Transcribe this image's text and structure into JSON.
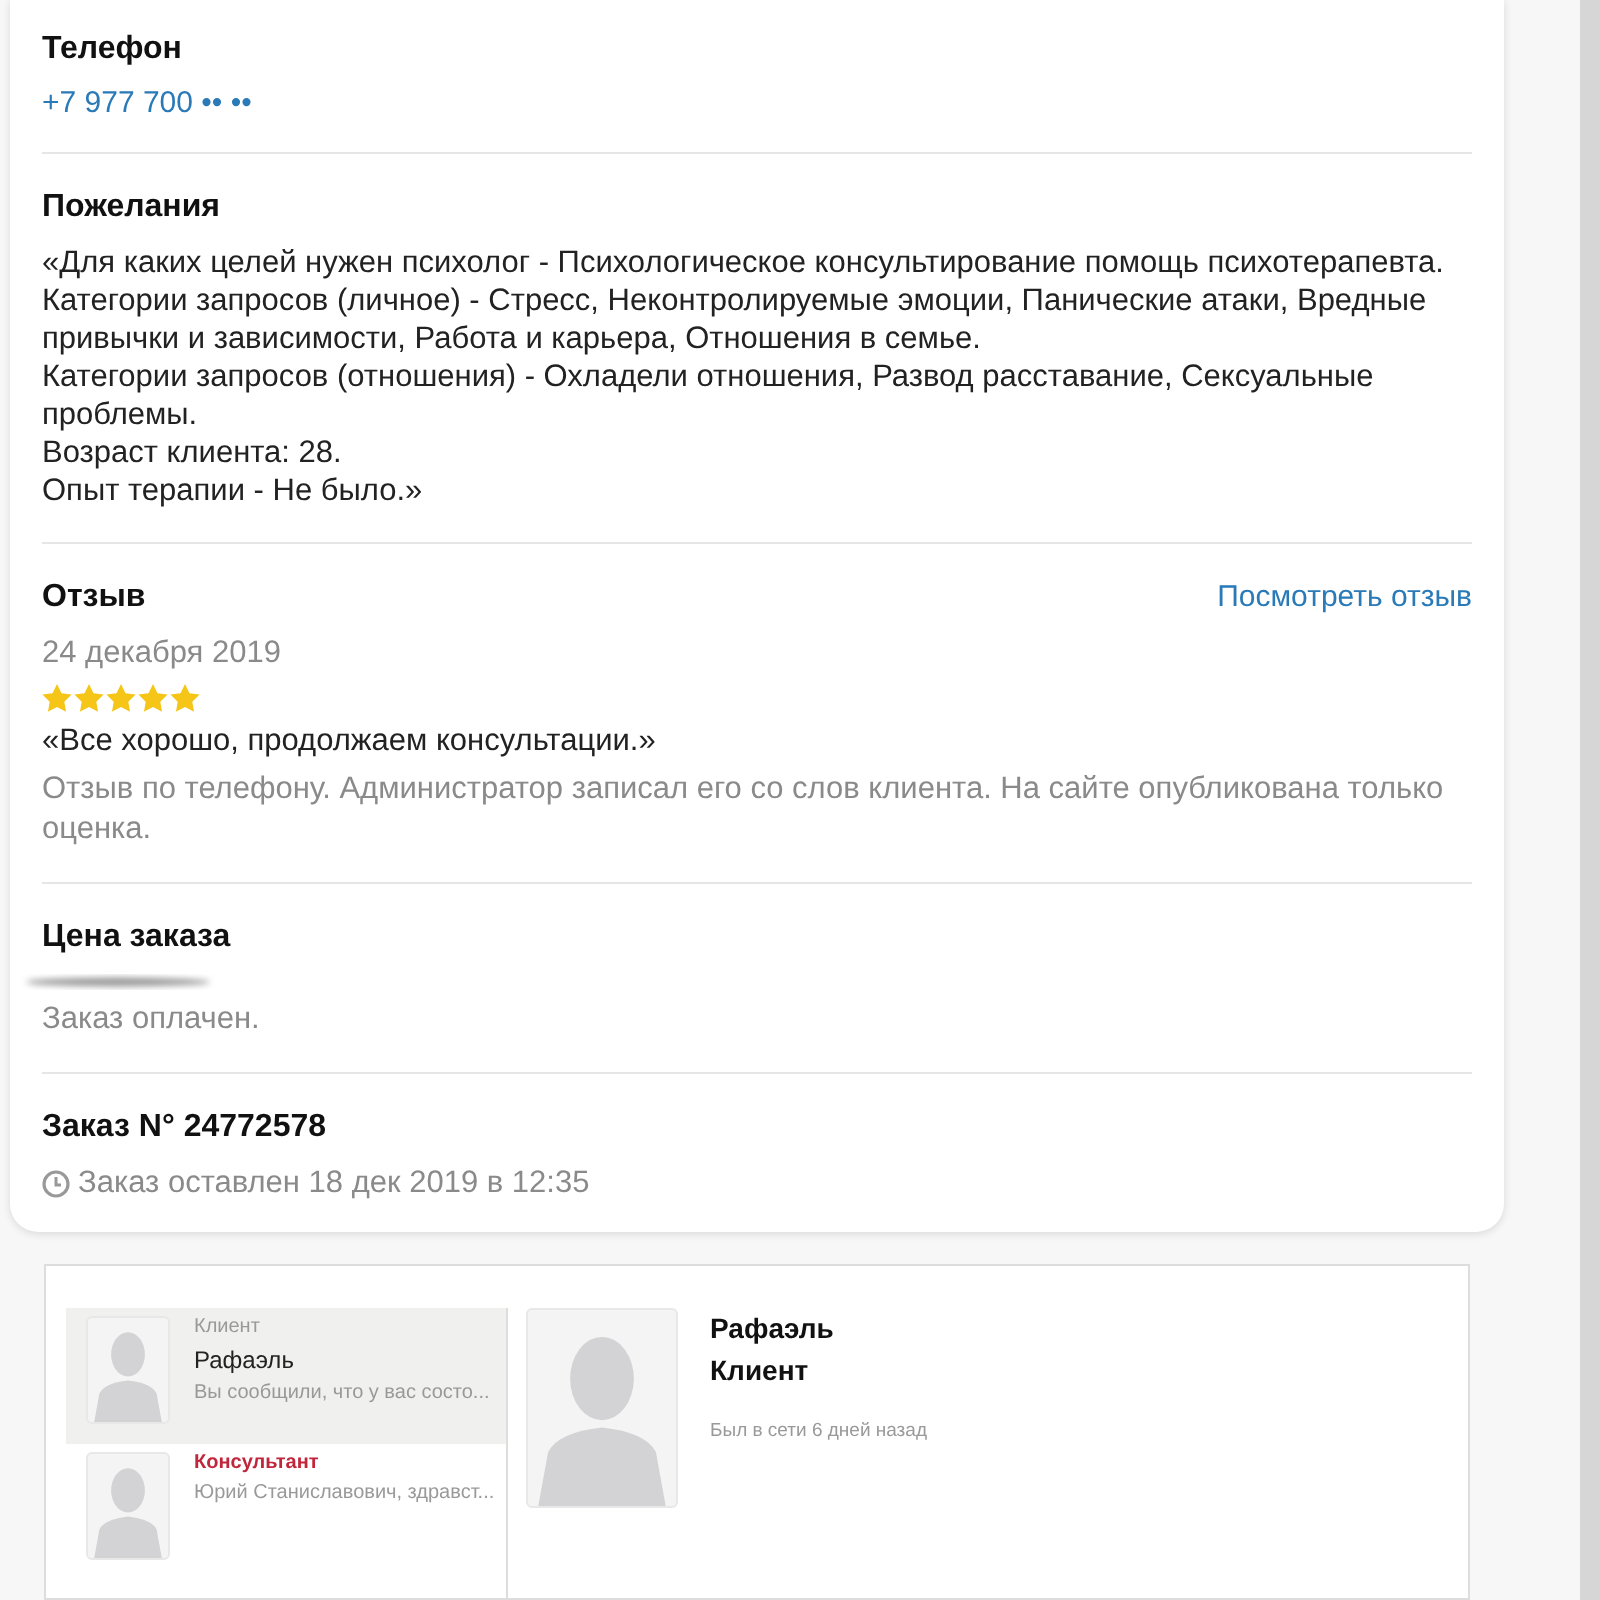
{
  "phone": {
    "title": "Телефон",
    "value": "+7 977 700 •• ••"
  },
  "wishes": {
    "title": "Пожелания",
    "lines": [
      "«Для каких целей нужен психолог - Психологическое консультирование помощь психотерапевта.",
      "Категории запросов (личное) - Стресс, Неконтролируемые эмоции, Панические атаки, Вредные привычки и зависимости, Работа и карьера, Отношения в семье.",
      "Категории запросов (отношения) - Охладели отношения, Развод расставание, Сексуальные проблемы.",
      "Возраст клиента: 28.",
      "Опыт терапии - Не было.»"
    ]
  },
  "review": {
    "title": "Отзыв",
    "link": "Посмотреть отзыв",
    "date": "24 декабря 2019",
    "stars": 5,
    "quote": "«Все хорошо, продолжаем консультации.»",
    "note": "Отзыв по телефону. Администратор записал его со слов клиента. На сайте опубликована только оценка."
  },
  "price": {
    "title": "Цена заказа",
    "status": "Заказ оплачен."
  },
  "order": {
    "title": "Заказ N° 24772578",
    "created": "Заказ оставлен 18 дек 2019 в 12:35"
  },
  "chats": [
    {
      "kind": "client",
      "role": "Клиент",
      "name": "Рафаэль",
      "preview": "Вы сообщили, что у вас состо...",
      "selected": true
    },
    {
      "kind": "consultant",
      "role": "Консультант",
      "preview": "Юрий Станиславович, здравст...",
      "selected": false
    }
  ],
  "profile": {
    "name": "Рафаэль",
    "role": "Клиент",
    "status": "Был в сети 6 дней назад"
  }
}
